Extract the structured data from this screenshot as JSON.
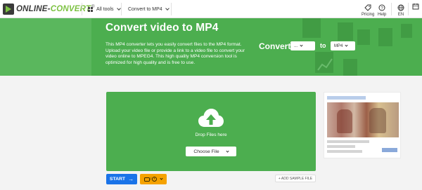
{
  "brand": {
    "name_part1": "ONLINE-",
    "name_part2": "CONVERT",
    "badge": "®"
  },
  "nav": {
    "all_tools": "All tools",
    "convert_to": "Convert to MP4",
    "pricing": "Pricing",
    "help": "Help",
    "language": "EN"
  },
  "hero": {
    "title": "Convert video to MP4",
    "description": "This MP4 converter lets you easily convert files to the MP4 format. Upload your video file or provide a link to a video file to convert your video online to MPEG4. This high quality MP4 conversion tool is optimized for high quality and is free to use.",
    "convert_label": "Convert",
    "from_value": "...",
    "to_label": "to",
    "to_value": "MP4"
  },
  "upload": {
    "drop_text": "Drop Files here",
    "choose_label": "Choose File"
  },
  "actions": {
    "start_label": "START",
    "sample_label": "+ ADD SAMPLE FILE"
  },
  "colors": {
    "hero_green": "#4cae4f",
    "start_blue": "#1a73e8",
    "options_orange": "#f5a200"
  },
  "icons": [
    "grid-icon",
    "chevron-down-icon",
    "tag-icon",
    "help-circle-icon",
    "globe-icon",
    "calendar-icon",
    "cloud-upload-icon",
    "arrow-right-icon",
    "storage-icon",
    "clock-icon"
  ]
}
